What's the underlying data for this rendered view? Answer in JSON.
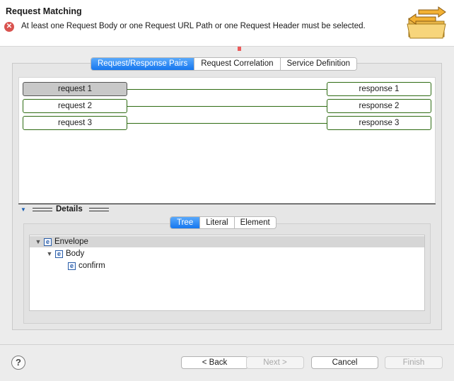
{
  "header": {
    "title": "Request Matching",
    "error_message": "At least one Request Body or one Request URL Path or one Request Header must be selected."
  },
  "tabs": [
    {
      "label": "Request/Response Pairs",
      "active": true
    },
    {
      "label": "Request Correlation",
      "active": false
    },
    {
      "label": "Service Definition",
      "active": false
    }
  ],
  "pairs": [
    {
      "request": "request 1",
      "response": "response 1",
      "selected": true
    },
    {
      "request": "request 2",
      "response": "response 2",
      "selected": false
    },
    {
      "request": "request 3",
      "response": "response 3",
      "selected": false
    }
  ],
  "details": {
    "label": "Details",
    "subtabs": [
      {
        "label": "Tree",
        "active": true
      },
      {
        "label": "Literal",
        "active": false
      },
      {
        "label": "Element",
        "active": false
      }
    ],
    "tree": [
      {
        "label": "Envelope",
        "icon": "e",
        "expanded": true
      },
      {
        "label": "Body",
        "icon": "e",
        "expanded": true
      },
      {
        "label": "confirm",
        "icon": "e"
      }
    ]
  },
  "footer": {
    "help": "?",
    "back": "< Back",
    "next": "Next >",
    "cancel": "Cancel",
    "finish": "Finish"
  },
  "colors": {
    "accent": "#1677ef",
    "pair_border": "#2e6b12",
    "error": "#d9534f"
  }
}
